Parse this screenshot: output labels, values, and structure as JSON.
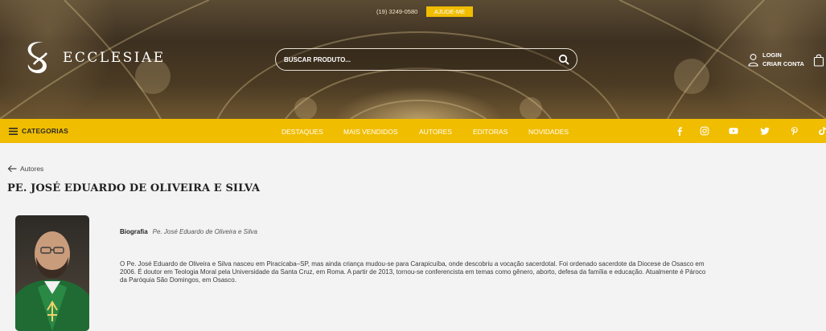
{
  "topbar": {
    "phone": "(19) 3249-0580",
    "help_label": "AJUDE-ME"
  },
  "brand": {
    "name": "ECCLESIAE",
    "logo_icon": "stylized-s-logo"
  },
  "search": {
    "placeholder": "BUSCAR PRODUTO...",
    "value": "",
    "icon": "search-icon"
  },
  "account": {
    "login_label": "LOGIN",
    "create_label": "CRIAR CONTA",
    "icon": "user-icon",
    "bag_icon": "shopping-bag-icon"
  },
  "nav": {
    "categories_label": "CATEGORIAS",
    "items": [
      {
        "label": "DESTAQUES"
      },
      {
        "label": "MAIS VENDIDOS"
      },
      {
        "label": "AUTORES"
      },
      {
        "label": "EDITORAS"
      },
      {
        "label": "NOVIDADES"
      }
    ],
    "social": [
      "facebook-icon",
      "instagram-icon",
      "youtube-icon",
      "twitter-icon",
      "pinterest-icon",
      "tiktok-icon"
    ]
  },
  "breadcrumb": {
    "back_label": "Autores"
  },
  "author": {
    "name": "PE. JOSÉ EDUARDO DE OLIVEIRA E SILVA",
    "bio_label": "Biografia",
    "bio_name": "Pe. José Eduardo de Oliveira e Silva",
    "bio_lines": [
      "O Pe. José Eduardo de Oliveira e Silva nasceu em Piracicaba–SP, mas ainda criança mudou-se para Carapicuíba, onde descobriu a vocação sacerdotal. Foi ordenado sacerdote da Diocese de Osasco em",
      "2006. É doutor em Teologia Moral pela Universidade da Santa Cruz, em Roma. A partir de 2013, tornou-se conferencista em temas como gênero, aborto, defesa da família e educação. Atualmente é Pároco",
      "da Paróquia São Domingos, em Osasco."
    ]
  },
  "colors": {
    "accent": "#f1bd00",
    "background": "#f3f3f3"
  }
}
